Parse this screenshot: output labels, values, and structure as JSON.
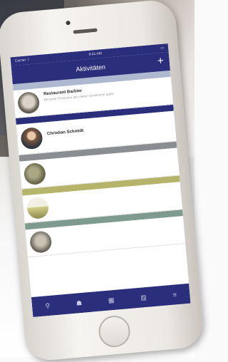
{
  "statusbar": {
    "carrier": "Carrier ⌔",
    "time": "9:41 AM",
    "battery": "▭"
  },
  "navbar": {
    "title": "Aktivitäten",
    "add_icon": "plus-icon"
  },
  "sections": [
    {
      "header": "",
      "color": "#aeb9cf",
      "rows": [
        {
          "title": "Restaurant Barbier",
          "desc": "Mit vielen Personen den netten Schlemmer gratis",
          "meta1": "",
          "meta2": "",
          "amount": ""
        }
      ]
    },
    {
      "header": "",
      "color": "#2b2e7a",
      "rows": [
        {
          "title": "Christian Schmidt",
          "desc": "",
          "meta1": "",
          "meta2": "",
          "amount": ""
        }
      ]
    },
    {
      "header": "",
      "color": "#8a8d92",
      "rows": [
        {
          "title": "",
          "desc": "",
          "meta1": "",
          "meta2": "",
          "amount": ""
        }
      ]
    },
    {
      "header": "",
      "color": "#b6b46a",
      "rows": [
        {
          "title": "",
          "desc": "",
          "meta1": "",
          "meta2": "",
          "amount": ""
        }
      ]
    },
    {
      "header": "",
      "color": "#7f9a8f",
      "rows": [
        {
          "title": "",
          "desc": "",
          "meta1": "",
          "meta2": "",
          "amount": ""
        }
      ]
    }
  ],
  "tabbar": [
    {
      "icon": "activity-icon",
      "label": ""
    },
    {
      "icon": "people-icon",
      "label": ""
    },
    {
      "icon": "calendar-icon",
      "label": ""
    },
    {
      "icon": "chart-icon",
      "label": ""
    },
    {
      "icon": "more-icon",
      "label": ""
    }
  ],
  "colors": {
    "brand": "#2b2e7a",
    "section_light": "#aeb9cf",
    "section_gray": "#8a8d92",
    "section_olive": "#b6b46a",
    "section_sage": "#7f9a8f"
  }
}
